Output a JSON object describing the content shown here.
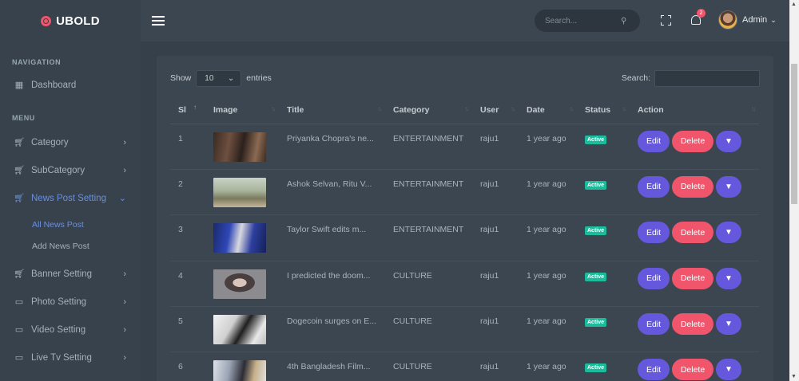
{
  "brand": {
    "name": "UBOLD",
    "accent": "#f1556c"
  },
  "sidebar": {
    "nav_title": "NAVIGATION",
    "menu_title": "MENU",
    "dashboard": {
      "label": "Dashboard",
      "icon": "grid-icon"
    },
    "items": [
      {
        "label": "Category",
        "icon": "cart-icon"
      },
      {
        "label": "SubCategory",
        "icon": "cart-icon"
      },
      {
        "label": "News Post Setting",
        "icon": "cart-icon",
        "active": true,
        "expanded": true
      },
      {
        "label": "Banner Setting",
        "icon": "cart-icon"
      },
      {
        "label": "Photo Setting",
        "icon": "image-icon"
      },
      {
        "label": "Video Setting",
        "icon": "image-icon"
      },
      {
        "label": "Live Tv Setting",
        "icon": "image-icon"
      }
    ],
    "subitems": [
      {
        "label": "All News Post",
        "active": true
      },
      {
        "label": "Add News Post"
      }
    ]
  },
  "topbar": {
    "search_placeholder": "Search...",
    "notification_count": "2",
    "user_name": "Admin"
  },
  "table_controls": {
    "show_label": "Show",
    "page_length": "10",
    "entries_label": "entries",
    "search_label": "Search:"
  },
  "table": {
    "columns": [
      "Sl",
      "Image",
      "Title",
      "Category",
      "User",
      "Date",
      "Status",
      "Action"
    ],
    "rows": [
      {
        "sl": "1",
        "title": "Priyanka Chopra's ne...",
        "category": "ENTERTAINMENT",
        "user": "raju1",
        "date": "1 year ago",
        "status": "Active"
      },
      {
        "sl": "2",
        "title": "Ashok Selvan, Ritu V...",
        "category": "ENTERTAINMENT",
        "user": "raju1",
        "date": "1 year ago",
        "status": "Active"
      },
      {
        "sl": "3",
        "title": "Taylor Swift edits m...",
        "category": "ENTERTAINMENT",
        "user": "raju1",
        "date": "1 year ago",
        "status": "Active"
      },
      {
        "sl": "4",
        "title": "I predicted the doom...",
        "category": "CULTURE",
        "user": "raju1",
        "date": "1 year ago",
        "status": "Active"
      },
      {
        "sl": "5",
        "title": "Dogecoin surges on E...",
        "category": "CULTURE",
        "user": "raju1",
        "date": "1 year ago",
        "status": "Active"
      },
      {
        "sl": "6",
        "title": "4th Bangladesh Film...",
        "category": "CULTURE",
        "user": "raju1",
        "date": "1 year ago",
        "status": "Active"
      }
    ],
    "edit_label": "Edit",
    "delete_label": "Delete"
  },
  "colors": {
    "status_active": "#1abc9c",
    "primary": "#6658dd",
    "danger": "#f1556c",
    "sidebar_active": "#6c8fdc"
  }
}
